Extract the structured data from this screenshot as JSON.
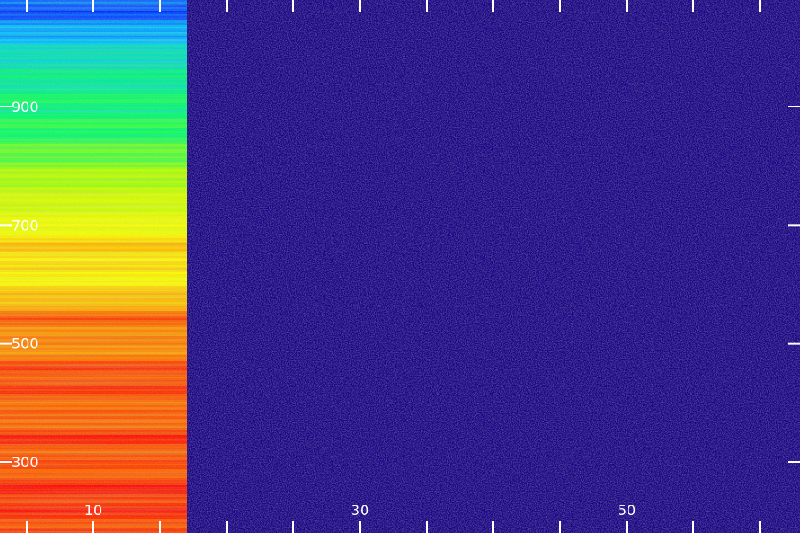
{
  "chart_data": {
    "type": "heatmap",
    "title": "",
    "xlabel": "",
    "ylabel": "",
    "xlim": [
      3,
      63
    ],
    "ylim": [
      180,
      1080
    ],
    "x_ticks": [
      {
        "value": 5,
        "label": ""
      },
      {
        "value": 10,
        "label": "10"
      },
      {
        "value": 15,
        "label": ""
      },
      {
        "value": 20,
        "label": ""
      },
      {
        "value": 25,
        "label": ""
      },
      {
        "value": 30,
        "label": "30"
      },
      {
        "value": 35,
        "label": ""
      },
      {
        "value": 40,
        "label": ""
      },
      {
        "value": 45,
        "label": ""
      },
      {
        "value": 50,
        "label": "50"
      },
      {
        "value": 55,
        "label": ""
      },
      {
        "value": 60,
        "label": ""
      }
    ],
    "y_ticks": [
      {
        "value": 300,
        "label": "300"
      },
      {
        "value": 500,
        "label": "500"
      },
      {
        "value": 700,
        "label": "700"
      },
      {
        "value": 900,
        "label": "900"
      }
    ],
    "grid": false,
    "colormap": "rainbow",
    "colormap_stops": [
      "#1a0070",
      "#0000ff",
      "#00c8ff",
      "#00ff64",
      "#b4ff00",
      "#ffff00",
      "#ff8c00",
      "#ff0000"
    ],
    "regions": [
      {
        "x_range": [
          3,
          17
        ],
        "profile": [
          {
            "y": 180,
            "level": 0.93
          },
          {
            "y": 250,
            "level": 0.96
          },
          {
            "y": 300,
            "level": 0.9
          },
          {
            "y": 340,
            "level": 0.95
          },
          {
            "y": 380,
            "level": 0.88
          },
          {
            "y": 420,
            "level": 0.93
          },
          {
            "y": 460,
            "level": 0.92
          },
          {
            "y": 500,
            "level": 0.84
          },
          {
            "y": 540,
            "level": 0.9
          },
          {
            "y": 580,
            "level": 0.77
          },
          {
            "y": 620,
            "level": 0.72
          },
          {
            "y": 660,
            "level": 0.78
          },
          {
            "y": 700,
            "level": 0.68
          },
          {
            "y": 740,
            "level": 0.63
          },
          {
            "y": 780,
            "level": 0.57
          },
          {
            "y": 820,
            "level": 0.5
          },
          {
            "y": 860,
            "level": 0.44
          },
          {
            "y": 900,
            "level": 0.42
          },
          {
            "y": 940,
            "level": 0.39
          },
          {
            "y": 980,
            "level": 0.36
          },
          {
            "y": 1020,
            "level": 0.28
          },
          {
            "y": 1050,
            "level": 0.22
          },
          {
            "y": 1080,
            "level": 0.19
          }
        ]
      },
      {
        "x_range": [
          17,
          63
        ],
        "level": 0.02
      }
    ]
  }
}
